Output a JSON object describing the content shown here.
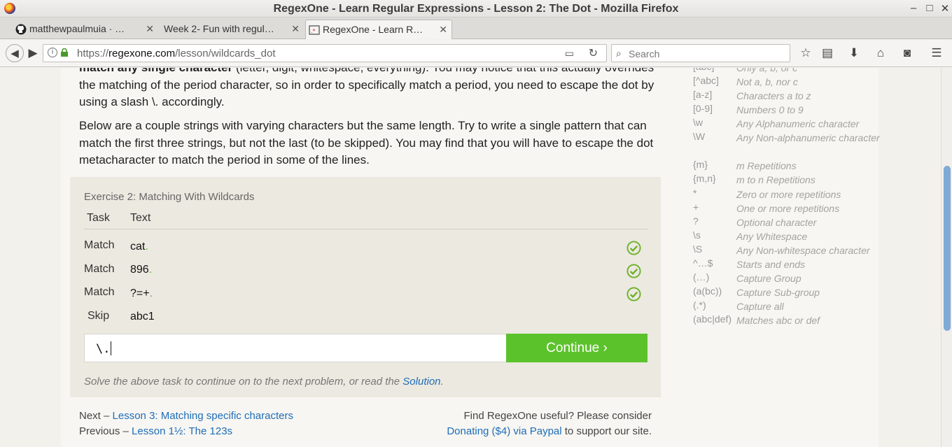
{
  "window": {
    "title": "RegexOne - Learn Regular Expressions - Lesson 2: The Dot - Mozilla Firefox"
  },
  "tabs": [
    {
      "label": "matthewpaulmuia · …",
      "icon": "github-icon"
    },
    {
      "label": "Week 2- Fun with regul…",
      "icon": "none"
    },
    {
      "label": "RegexOne - Learn R…",
      "icon": "regexone-icon",
      "active": true
    }
  ],
  "navbar": {
    "url_prefix": "https://",
    "url_domain": "regexone.com",
    "url_path": "/lesson/wildcards_dot",
    "search_placeholder": "Search"
  },
  "lesson": {
    "para1_bold": "match any single character",
    "para1_rest": " (letter, digit, whitespace, everything). You may notice that this actually overrides the matching of the period character, so in order to specifically match a period, you need to escape the dot by using a slash \\. accordingly.",
    "para2": "Below are a couple strings with varying characters but the same length. Try to write a single pattern that can match the first three strings, but not the last (to be skipped). You may find that you will have to escape the dot metacharacter to match the period in some of the lines."
  },
  "exercise": {
    "title": "Exercise 2: Matching With Wildcards",
    "col_task": "Task",
    "col_text": "Text",
    "rows": [
      {
        "task": "Match",
        "text": "cat",
        "suffix": ".",
        "passed": true
      },
      {
        "task": "Match",
        "text": "896",
        "suffix": ".",
        "passed": true
      },
      {
        "task": "Match",
        "text": "?=+",
        "suffix": ".",
        "passed": true
      },
      {
        "task": "Skip",
        "text": "abc1",
        "suffix": "",
        "passed": false
      }
    ],
    "input_value": "\\.",
    "continue_label": "Continue ›",
    "hint_pre": "Solve the above task to continue on to the next problem, or read the ",
    "hint_link": "Solution",
    "hint_post": "."
  },
  "footer": {
    "next_prefix": "Next – ",
    "next_link": "Lesson 3: Matching specific characters",
    "prev_prefix": "Previous – ",
    "prev_link": "Lesson 1½: The 123s",
    "donate_line1": "Find RegexOne useful? Please consider",
    "donate_link": "Donating ($4) via Paypal",
    "donate_post": " to support our site."
  },
  "cheatsheet": [
    {
      "key": "[abc]",
      "val": "Only a, b, or c"
    },
    {
      "key": "[^abc]",
      "val": "Not a, b, nor c"
    },
    {
      "key": "[a-z]",
      "val": "Characters a to z"
    },
    {
      "key": "[0-9]",
      "val": "Numbers 0 to 9"
    },
    {
      "key": "\\w",
      "val": "Any Alphanumeric character"
    },
    {
      "key": "\\W",
      "val": "Any Non-alphanumeric character"
    },
    {
      "key": "{m}",
      "val": "m Repetitions"
    },
    {
      "key": "{m,n}",
      "val": "m to n Repetitions"
    },
    {
      "key": "*",
      "val": "Zero or more repetitions"
    },
    {
      "key": "+",
      "val": "One or more repetitions"
    },
    {
      "key": "?",
      "val": "Optional character"
    },
    {
      "key": "\\s",
      "val": "Any Whitespace"
    },
    {
      "key": "\\S",
      "val": "Any Non-whitespace character"
    },
    {
      "key": "^…$",
      "val": "Starts and ends"
    },
    {
      "key": "(…)",
      "val": "Capture Group"
    },
    {
      "key": "(a(bc))",
      "val": "Capture Sub-group"
    },
    {
      "key": "(.*)",
      "val": "Capture all"
    },
    {
      "key": "(abc|def)",
      "val": "Matches abc or def"
    }
  ],
  "colors": {
    "accent_green": "#5cc22c",
    "link_blue": "#1f6db8",
    "check_green": "#6fb12a"
  }
}
